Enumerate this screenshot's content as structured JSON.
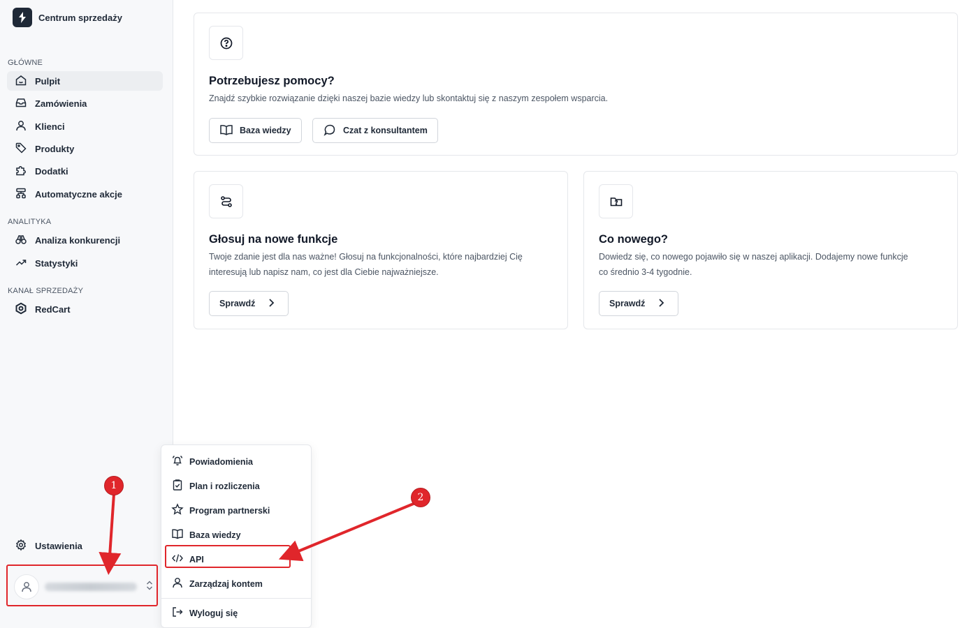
{
  "app": {
    "title": "Centrum sprzedaży"
  },
  "sidebar": {
    "sections": [
      {
        "label": "GŁÓWNE"
      },
      {
        "label": "ANALITYKA"
      },
      {
        "label": "KANAŁ SPRZEDAŻY"
      }
    ],
    "items": [
      {
        "label": "Pulpit",
        "icon": "home-icon"
      },
      {
        "label": "Zamówienia",
        "icon": "inbox-icon"
      },
      {
        "label": "Klienci",
        "icon": "user-icon"
      },
      {
        "label": "Produkty",
        "icon": "tag-icon"
      },
      {
        "label": "Dodatki",
        "icon": "puzzle-icon"
      },
      {
        "label": "Automatyczne akcje",
        "icon": "workflow-icon"
      },
      {
        "label": "Analiza konkurencji",
        "icon": "binoculars-icon"
      },
      {
        "label": "Statystyki",
        "icon": "trending-up-icon"
      },
      {
        "label": "RedCart",
        "icon": "redcart-logo-icon"
      }
    ],
    "settings": {
      "label": "Ustawienia",
      "icon": "gear-icon"
    }
  },
  "cards": {
    "help": {
      "title": "Potrzebujesz pomocy?",
      "description": "Znajdź szybkie rozwiązanie dzięki naszej bazie wiedzy lub skontaktuj się z naszym zespołem wsparcia.",
      "buttons": [
        {
          "label": "Baza wiedzy",
          "icon": "book-icon"
        },
        {
          "label": "Czat z konsultantem",
          "icon": "chat-icon"
        }
      ]
    },
    "vote": {
      "title": "Głosuj na nowe funkcje",
      "description_line1": "Twoje zdanie jest dla nas ważne! Głosuj na funkcjonalności, które najbardziej Cię",
      "description_line2": "interesują lub napisz nam, co jest dla Ciebie najważniejsze.",
      "button": "Sprawdź"
    },
    "news": {
      "title": "Co nowego?",
      "description_line1": "Dowiedz się, co nowego pojawiło się w naszej aplikacji. Dodajemy nowe funkcje",
      "description_line2": "co średnio 3-4 tygodnie.",
      "button": "Sprawdź"
    }
  },
  "user_menu": {
    "items": [
      {
        "label": "Powiadomienia",
        "icon": "bell-icon"
      },
      {
        "label": "Plan i rozliczenia",
        "icon": "clipboard-check-icon"
      },
      {
        "label": "Program partnerski",
        "icon": "star-icon"
      },
      {
        "label": "Baza wiedzy",
        "icon": "book-icon"
      },
      {
        "label": "API",
        "icon": "code-icon"
      },
      {
        "label": "Zarządzaj kontem",
        "icon": "user-icon"
      },
      {
        "label": "Wyloguj się",
        "icon": "logout-icon"
      }
    ]
  },
  "annotations": {
    "badge_1": "1",
    "badge_2": "2",
    "color": "#e0262b"
  }
}
